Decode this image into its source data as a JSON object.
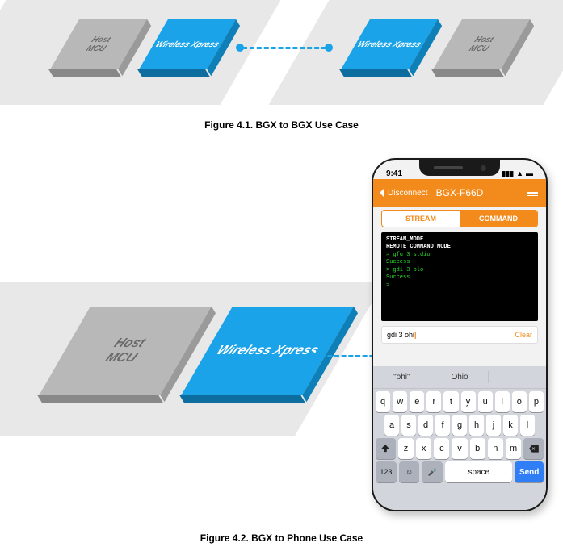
{
  "figure1": {
    "caption": "Figure 4.1.  BGX to BGX Use Case",
    "left": {
      "mcu": "Host\nMCU",
      "xpress": "Wireless Xpress"
    },
    "right": {
      "mcu": "Host\nMCU",
      "xpress": "Wireless Xpress"
    }
  },
  "figure2": {
    "caption": "Figure 4.2.  BGX to Phone Use Case",
    "mcu": "Host\nMCU",
    "xpress": "Wireless Xpress"
  },
  "phone": {
    "time": "9:41",
    "nav": {
      "back": "Disconnect",
      "title": "BGX-F66D"
    },
    "tabs": {
      "stream": "STREAM",
      "command": "COMMAND"
    },
    "terminal": {
      "l1": "STREAM_MODE",
      "l2": "REMOTE_COMMAND_MODE",
      "l3": "> gfu 3 stdio",
      "l4": "Success",
      "l5": "> gdi 3 olo",
      "l6": "Success",
      "l7": ">"
    },
    "input": {
      "text": "gdi 3 ohi",
      "clear": "Clear"
    },
    "suggest": [
      "\"ohi\"",
      "Ohio",
      ""
    ],
    "rows": {
      "r1": [
        "q",
        "w",
        "e",
        "r",
        "t",
        "y",
        "u",
        "i",
        "o",
        "p"
      ],
      "r2": [
        "a",
        "s",
        "d",
        "f",
        "g",
        "h",
        "j",
        "k",
        "l"
      ],
      "r3": [
        "z",
        "x",
        "c",
        "v",
        "b",
        "n",
        "m"
      ]
    },
    "bottom": {
      "num": "123",
      "emoji": "☺",
      "mic": "🎤",
      "space": "space",
      "send": "Send"
    }
  }
}
